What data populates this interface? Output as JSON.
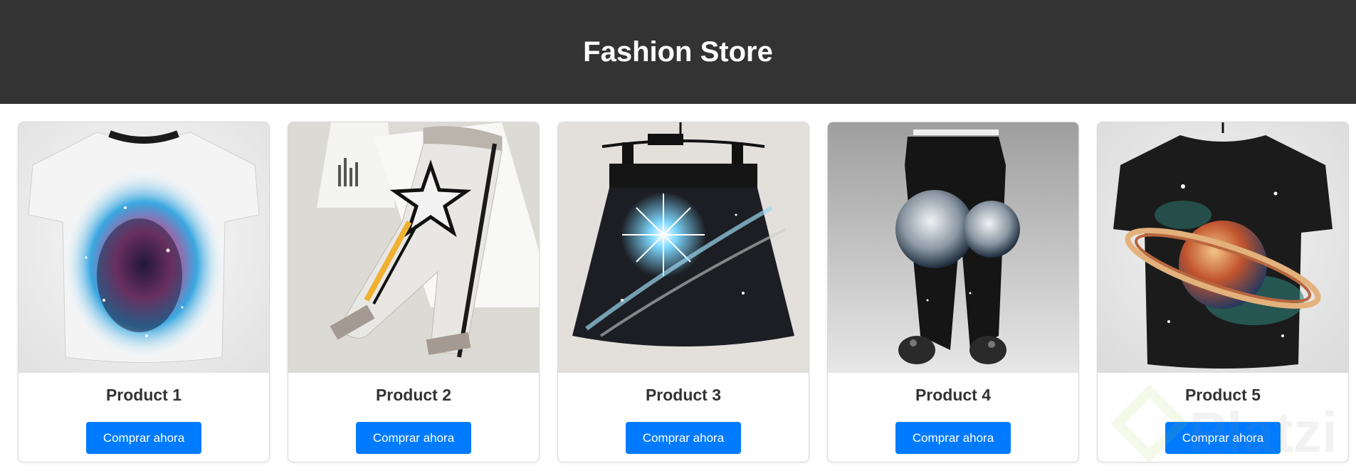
{
  "header": {
    "title": "Fashion Store"
  },
  "products": [
    {
      "name": "Product 1",
      "button_label": "Comprar ahora",
      "image": "galaxy-tshirt"
    },
    {
      "name": "Product 2",
      "button_label": "Comprar ahora",
      "image": "star-pants"
    },
    {
      "name": "Product 3",
      "button_label": "Comprar ahora",
      "image": "starburst-skirt"
    },
    {
      "name": "Product 4",
      "button_label": "Comprar ahora",
      "image": "moon-joggers"
    },
    {
      "name": "Product 5",
      "button_label": "Comprar ahora",
      "image": "planet-tshirt"
    }
  ],
  "watermark": {
    "text": "Platzi"
  },
  "colors": {
    "header_bg": "#333333",
    "button": "#007bff"
  }
}
